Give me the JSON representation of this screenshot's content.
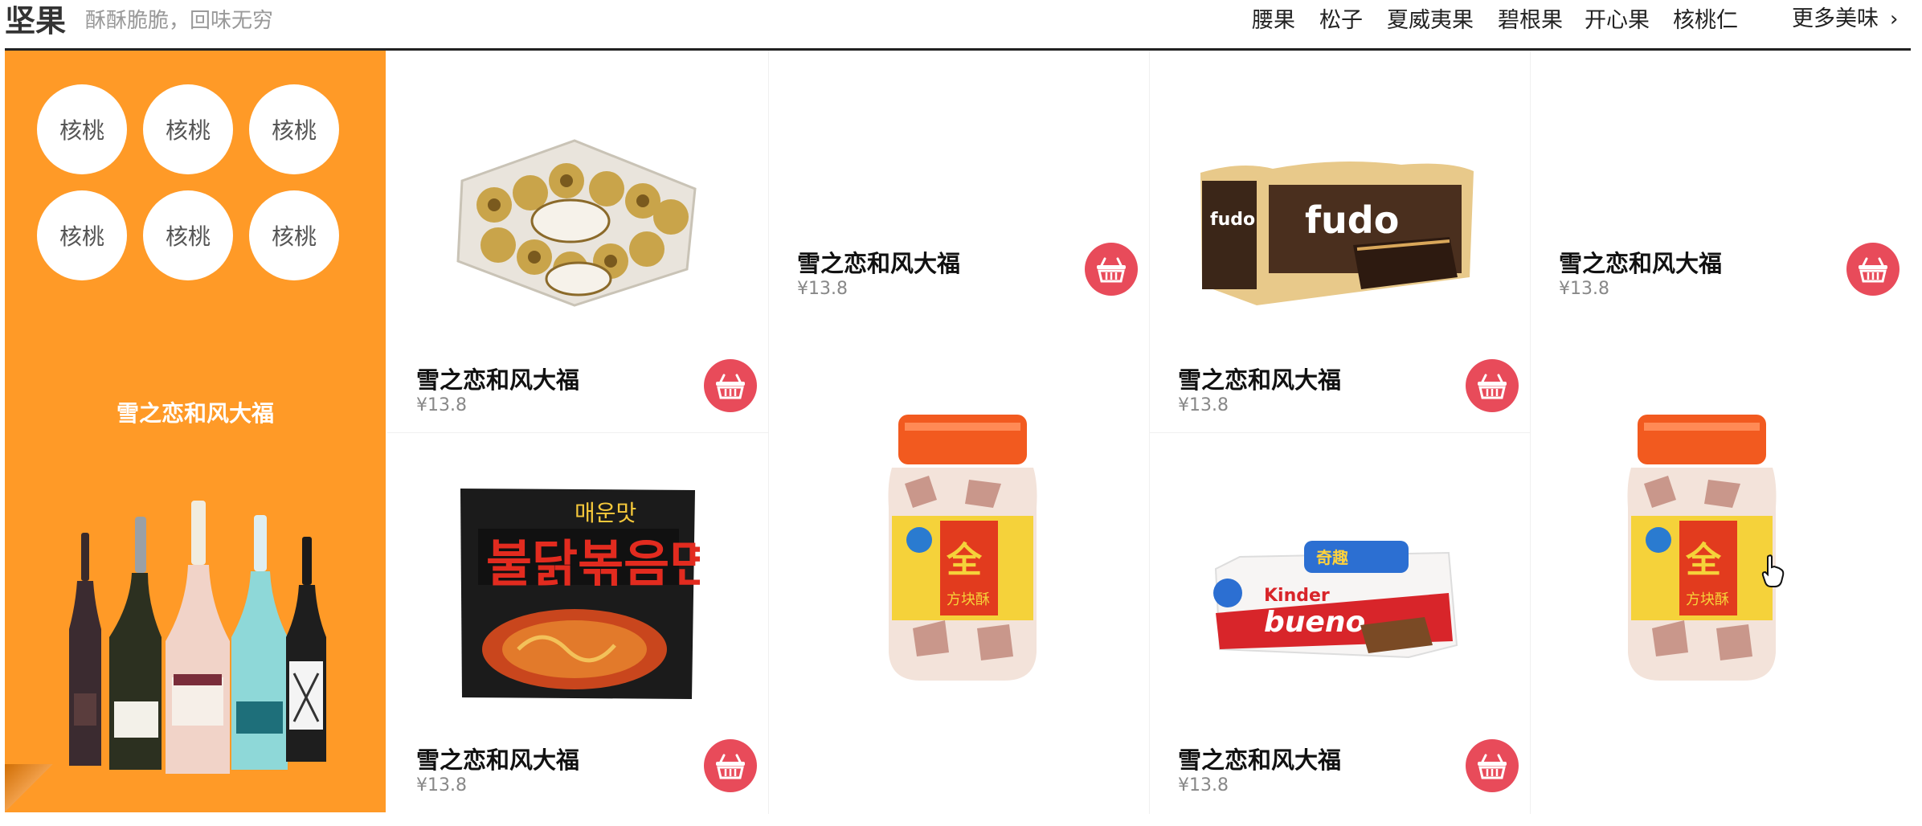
{
  "header": {
    "title": "坚果",
    "subtitle": "酥酥脆脆，回味无穷",
    "nav": [
      "腰果",
      "松子",
      "夏威夷果",
      "碧根果",
      "开心果",
      "核桃仁"
    ],
    "more": "更多美味",
    "more_icon": "chevron-right-icon"
  },
  "sidebar": {
    "tags": [
      "核桃",
      "核桃",
      "核桃",
      "核桃",
      "核桃",
      "核桃"
    ],
    "title": "雪之恋和风大福",
    "image": "wine-bottles"
  },
  "products": [
    {
      "name": "雪之恋和风大福",
      "price": "¥13.8",
      "image": "ferrero-rocher-box"
    },
    {
      "name": "雪之恋和风大福",
      "price": "¥13.8",
      "image": "none"
    },
    {
      "name": "雪之恋和风大福",
      "price": "¥13.8",
      "image": "fudo-wafer"
    },
    {
      "name": "雪之恋和风大福",
      "price": "¥13.8",
      "image": "none"
    },
    {
      "name": "雪之恋和风大福",
      "price": "¥13.8",
      "image": "buldak-ramen"
    },
    {
      "name": "",
      "price": "",
      "image": "biscuit-jar"
    },
    {
      "name": "雪之恋和风大福",
      "price": "¥13.8",
      "image": "kinder-bueno"
    },
    {
      "name": "",
      "price": "",
      "image": "biscuit-jar"
    }
  ],
  "icons": {
    "cart": "shopping-basket-icon",
    "cursor": "hand-cursor-icon"
  },
  "colors": {
    "accent_orange": "#ff9a27",
    "cart_red": "#e84b5a"
  }
}
